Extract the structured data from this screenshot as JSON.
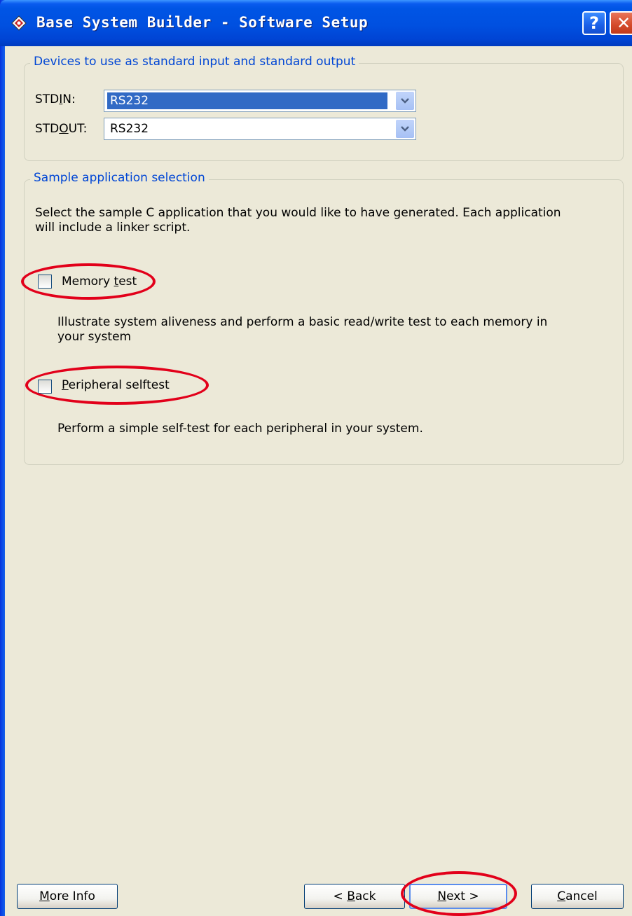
{
  "window": {
    "title": "Base System Builder - Software Setup",
    "help_glyph": "?",
    "close_glyph": "✕"
  },
  "io_group": {
    "legend": "Devices to use as standard input and standard output",
    "stdin": {
      "label_pre": "STD",
      "label_u": "I",
      "label_post": "N:",
      "value": "RS232"
    },
    "stdout": {
      "label_pre": "STD",
      "label_u": "O",
      "label_post": "UT:",
      "value": "RS232"
    }
  },
  "app_group": {
    "legend": "Sample application selection",
    "intro_line1": "Select the sample C application that you would like to have generated.  Each application",
    "intro_line2": "will include a linker script.",
    "memory_test": {
      "label_pre": "Memory ",
      "label_u": "t",
      "label_post": "est",
      "checked": false,
      "desc_line1": "Illustrate system aliveness and perform a basic read/write test to each memory in",
      "desc_line2": "your system"
    },
    "peripheral_test": {
      "label_pre": "",
      "label_u": "P",
      "label_post": "eripheral selftest",
      "checked": false,
      "desc_line1": "Perform a simple self-test for each peripheral in your system."
    }
  },
  "buttons": {
    "more_info": {
      "u": "M",
      "rest": "ore Info"
    },
    "back": {
      "pre": "< ",
      "u": "B",
      "rest": "ack"
    },
    "next": {
      "u": "N",
      "rest": "ext >"
    },
    "cancel": {
      "u": "C",
      "rest": "ancel"
    }
  },
  "colors": {
    "accent": "#0046D5",
    "selection": "#316AC5",
    "annotation": "#E2001A",
    "dialog_bg": "#ECE9D8"
  },
  "icons": [
    "xilinx-logo-icon",
    "help-icon",
    "close-icon",
    "chevron-down-icon"
  ]
}
